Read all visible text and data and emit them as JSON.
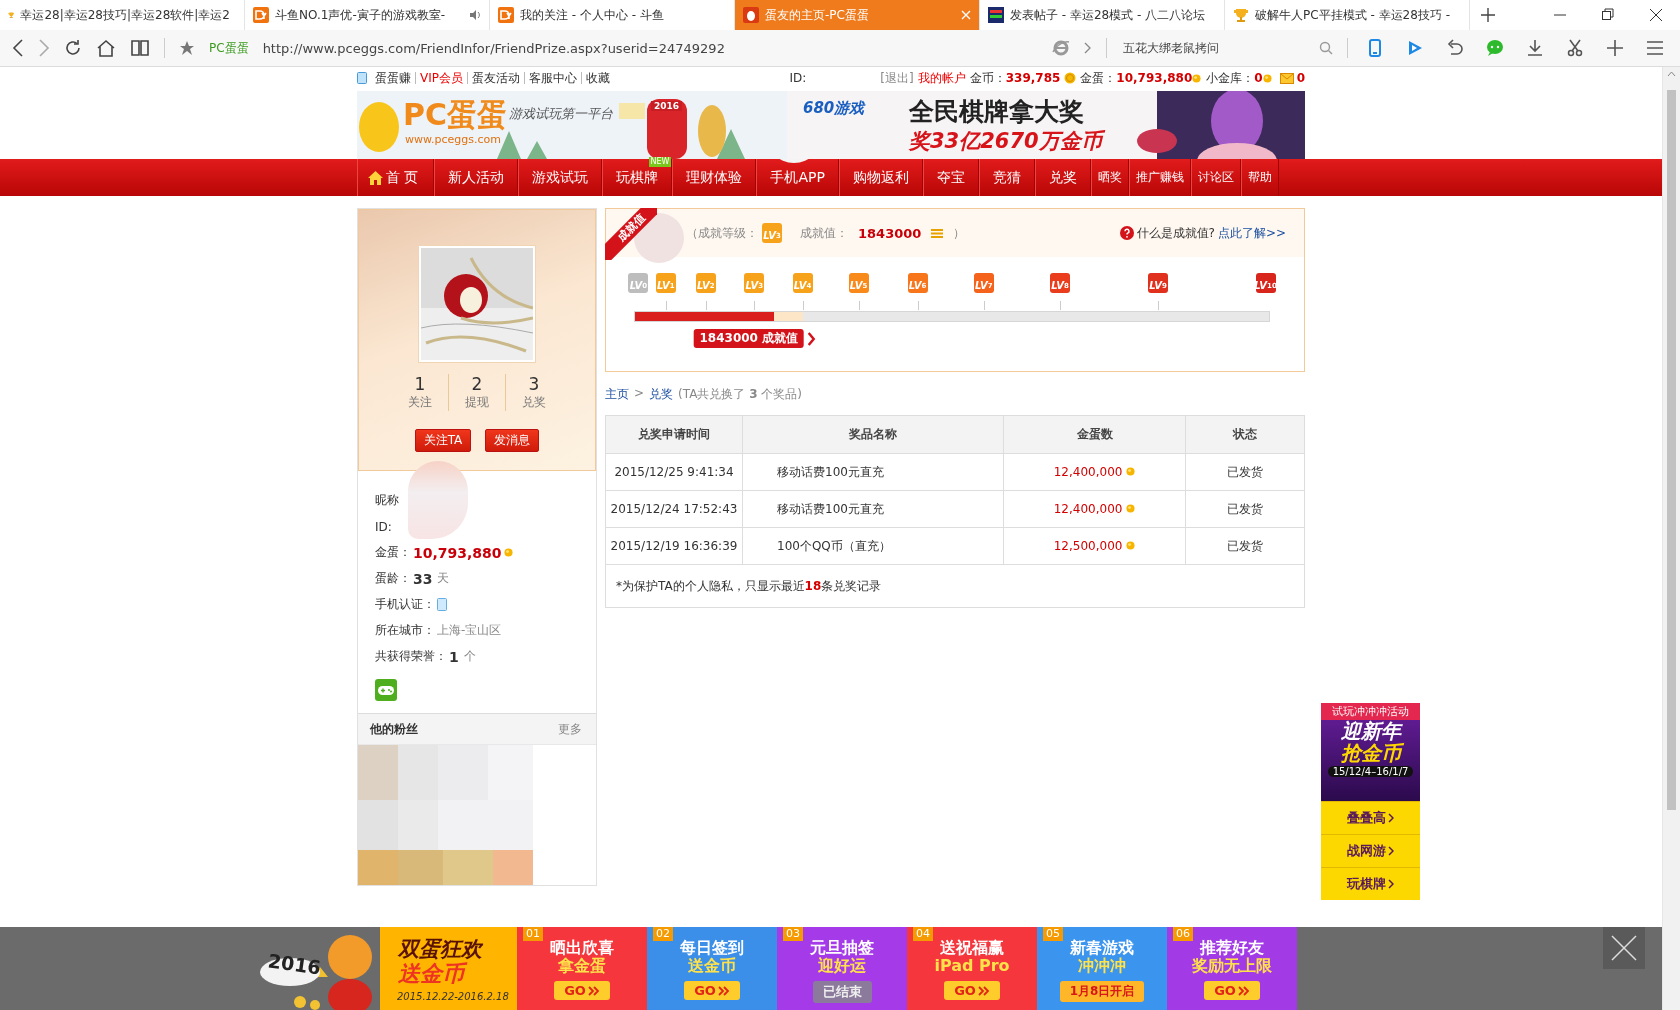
{
  "browser": {
    "tabs": [
      {
        "title": "幸运28|幸运28技巧|幸运28软件|幸运2",
        "kind": "trophy",
        "selected": false,
        "audio": false
      },
      {
        "title": "斗鱼NO.1声优-寅子的游戏教室-",
        "kind": "dy",
        "selected": false,
        "audio": true
      },
      {
        "title": "我的关注 - 个人中心 - 斗鱼",
        "kind": "dy",
        "selected": false,
        "audio": false
      },
      {
        "title": "蛋友的主页-PC蛋蛋",
        "kind": "egg",
        "selected": true,
        "audio": false
      },
      {
        "title": "发表帖子 - 幸运28模式 - 八二八论坛",
        "kind": "forum",
        "selected": false,
        "audio": false
      },
      {
        "title": "破解牛人PC平挂模式 - 幸运28技巧 -",
        "kind": "trophy",
        "selected": false,
        "audio": false
      }
    ],
    "site_label": "PC蛋蛋",
    "url": "http://www.pceggs.com/FriendInfor/FriendPrize.aspx?userid=24749292",
    "search": "五花大绑老鼠拷问"
  },
  "top_links": [
    {
      "label": "蛋蛋赚",
      "hot": false
    },
    {
      "label": "VIP会员",
      "hot": true
    },
    {
      "label": "蛋友活动",
      "hot": false
    },
    {
      "label": "客服中心",
      "hot": false
    },
    {
      "label": "收藏",
      "hot": false
    }
  ],
  "account": {
    "id_label": "ID:",
    "logout": "[退出]",
    "my_account": "我的帐户",
    "coins_label": "金币：",
    "coins": "339,785",
    "eggs_label": "金蛋：",
    "eggs": "10,793,880",
    "vault_label": "小金库：",
    "vault": "0",
    "messages": "0"
  },
  "banner": {
    "logo": "PC蛋蛋",
    "url": "www.pceggs.com",
    "slogan": "游戏试玩第一平台",
    "year": "2016",
    "ad_brand": "680游戏",
    "ad_title": "全民棋牌拿大奖",
    "ad_sub": "奖33亿2670万金币"
  },
  "nav": [
    {
      "label": "首 页",
      "kind": "home"
    },
    {
      "label": "新人活动",
      "kind": "main"
    },
    {
      "label": "游戏试玩",
      "kind": "main"
    },
    {
      "label": "玩棋牌",
      "kind": "main",
      "badge": "NEW"
    },
    {
      "label": "理财体验",
      "kind": "main"
    },
    {
      "label": "手机APP",
      "kind": "main"
    },
    {
      "label": "购物返利",
      "kind": "main"
    },
    {
      "label": "夺宝",
      "kind": "main"
    },
    {
      "label": "竞猜",
      "kind": "main"
    },
    {
      "label": "兑奖",
      "kind": "main"
    },
    {
      "label": "晒奖",
      "kind": "minor"
    },
    {
      "label": "推广赚钱",
      "kind": "minor"
    },
    {
      "label": "讨论区",
      "kind": "minor"
    },
    {
      "label": "帮助",
      "kind": "minor"
    }
  ],
  "profile": {
    "stats": [
      {
        "value": "1",
        "label": "关注"
      },
      {
        "value": "2",
        "label": "提现"
      },
      {
        "value": "3",
        "label": "兑奖"
      }
    ],
    "buttons": [
      "关注TA",
      "发消息"
    ],
    "fields": [
      {
        "label": "昵称",
        "kind": "plain"
      },
      {
        "label": "ID:",
        "kind": "plain"
      },
      {
        "label": "金蛋：",
        "value": "10,793,880",
        "kind": "eggs"
      },
      {
        "label": "蛋龄：",
        "value": "33",
        "unit": "天",
        "kind": "count"
      },
      {
        "label": "手机认证：",
        "kind": "phone"
      },
      {
        "label": "所在城市：",
        "value": "上海-宝山区",
        "kind": "city"
      },
      {
        "label": "共获得荣誉：",
        "value": "1",
        "unit": "个",
        "kind": "count"
      }
    ],
    "fans_title": "他的粉丝",
    "fans_more": "更多"
  },
  "achievement": {
    "ribbon": "成就值",
    "level_label": "（成就等级：",
    "badge": {
      "text": "LV",
      "sub": "3",
      "color": "#f7a21b"
    },
    "value_label": "成就值：",
    "value": "1843000",
    "close": "）",
    "help": "什么是成就值?",
    "help_link": "点此了解>>",
    "levels": [
      {
        "text": "LV",
        "sub": "0",
        "color": "#bdbdbd"
      },
      {
        "text": "LV",
        "sub": "1",
        "color": "#f7a21b"
      },
      {
        "text": "LV",
        "sub": "2",
        "color": "#f7a21b"
      },
      {
        "text": "LV",
        "sub": "3",
        "color": "#f7a21b"
      },
      {
        "text": "LV",
        "sub": "4",
        "color": "#f7a21b"
      },
      {
        "text": "LV",
        "sub": "5",
        "color": "#f78a1b"
      },
      {
        "text": "LV",
        "sub": "6",
        "color": "#f7751b"
      },
      {
        "text": "LV",
        "sub": "7",
        "color": "#f5621b"
      },
      {
        "text": "LV",
        "sub": "8",
        "color": "#ea3d1e"
      },
      {
        "text": "LV",
        "sub": "9",
        "color": "#e0301e"
      },
      {
        "text": "LV",
        "sub": "10",
        "color": "#d9261c"
      }
    ],
    "level": 0.22,
    "callout": "1843000 成就值"
  },
  "breadcrumb": {
    "home": "主页",
    "sep": ">",
    "current": "兑奖",
    "summary": "(TA共兑换了 **3** 个奖品)"
  },
  "prize_table": {
    "columns": [
      "兑奖申请时间",
      "奖品名称",
      "金蛋数",
      "状态"
    ],
    "rows": [
      {
        "time": "2015/12/25 9:41:34",
        "prize": "移动话费100元直充",
        "eggs": "12,400,000",
        "status": "已发货"
      },
      {
        "time": "2015/12/24 17:52:43",
        "prize": "移动话费100元直充",
        "eggs": "12,400,000",
        "status": "已发货"
      },
      {
        "time": "2015/12/19 16:36:39",
        "prize": "100个QQ币（直充）",
        "eggs": "12,500,000",
        "status": "已发货"
      }
    ],
    "note": "*为保护TA的个人隐私，只显示最近**18**条兑奖记录"
  },
  "side_ad": {
    "tag": "试玩冲冲冲活动",
    "title_1": "迎新年",
    "title_2": "抢金币",
    "dates": "15/12/4–16/1/7",
    "links": [
      "叠叠高",
      "战网游",
      "玩棋牌"
    ]
  },
  "promo_bar": {
    "main": {
      "year": "2016",
      "title": "双蛋狂欢",
      "subtitle": "送金币",
      "dates": "2015.12.22-2016.2.18"
    },
    "tiles": [
      {
        "num": "01",
        "title": "晒出欣喜",
        "subtitle": "拿金蛋",
        "button": "GO",
        "kind": "go",
        "color": "#f5363c"
      },
      {
        "num": "02",
        "title": "每日签到",
        "subtitle": "送金币",
        "button": "GO",
        "kind": "go",
        "color": "#3b8fe8"
      },
      {
        "num": "03",
        "title": "元旦抽签",
        "subtitle": "迎好运",
        "button": "已结束",
        "kind": "ended",
        "color": "#a53be8"
      },
      {
        "num": "04",
        "title": "送祝福赢",
        "subtitle": "iPad Pro",
        "button": "GO",
        "kind": "go",
        "color": "#f5363c"
      },
      {
        "num": "05",
        "title": "新春游戏",
        "subtitle": "冲冲冲",
        "button": "1月8日开启",
        "kind": "date",
        "color": "#3b95ee"
      },
      {
        "num": "06",
        "title": "推荐好友",
        "subtitle": "奖励无上限",
        "button": "GO",
        "kind": "go",
        "color": "#a23ae6"
      }
    ]
  }
}
